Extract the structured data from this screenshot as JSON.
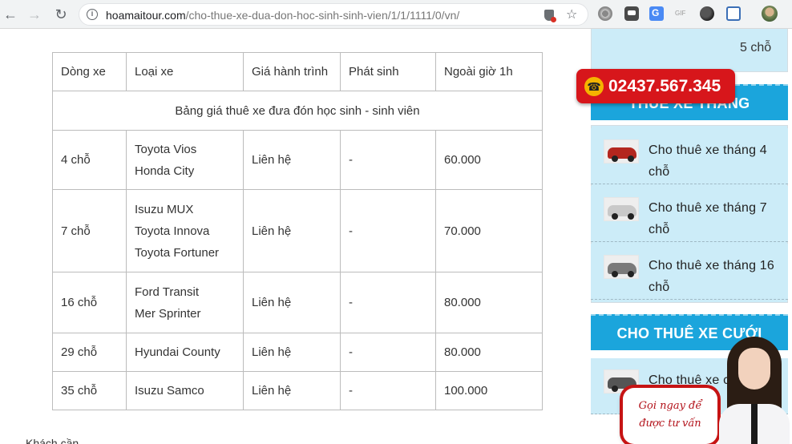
{
  "browser": {
    "url_domain": "hoamaitour.com",
    "url_path": "/cho-thue-xe-dua-don-hoc-sinh-sinh-vien/1/1/1111/0/vn/",
    "ext_gif_label": "GIF"
  },
  "table": {
    "caption": "Bảng giá thuê xe đưa đón học sinh - sinh viên",
    "headers": [
      "Dòng xe",
      "Loại xe",
      "Giá hành trình",
      "Phát sinh",
      "Ngoài giờ 1h"
    ],
    "rows": [
      {
        "line": "4 chỗ",
        "models": [
          "Toyota Vios",
          "Honda City"
        ],
        "price": "Liên hệ",
        "extra": "-",
        "overtime": "60.000"
      },
      {
        "line": "7 chỗ",
        "models": [
          "Isuzu MUX",
          "Toyota Innova",
          "Toyota Fortuner"
        ],
        "price": "Liên hệ",
        "extra": "-",
        "overtime": "70.000"
      },
      {
        "line": "16 chỗ",
        "models": [
          "Ford Transit",
          "Mer Sprinter"
        ],
        "price": "Liên hệ",
        "extra": "-",
        "overtime": "80.000"
      },
      {
        "line": "29 chỗ",
        "models": [
          "Hyundai County"
        ],
        "price": "Liên hệ",
        "extra": "-",
        "overtime": "80.000"
      },
      {
        "line": "35 chỗ",
        "models": [
          "Isuzu Samco"
        ],
        "price": "Liên hệ",
        "extra": "-",
        "overtime": "100.000"
      }
    ]
  },
  "below_text": "Khách cần ...",
  "sidebar": {
    "top_item_partial": "5 chỗ",
    "section_monthly": "THUÊ XE THÁNG",
    "monthly_items": [
      "Cho thuê xe tháng 4 chỗ",
      "Cho thuê xe tháng 7 chỗ",
      "Cho thuê xe tháng 16 chỗ"
    ],
    "section_wedding": "CHO THUÊ XE CƯỚI",
    "wedding_item_partial": "Cho thuê xe c... chỗ"
  },
  "hotline": "02437.567.345",
  "call_now": [
    "Gọi ngay để",
    "được tư vấn"
  ]
}
